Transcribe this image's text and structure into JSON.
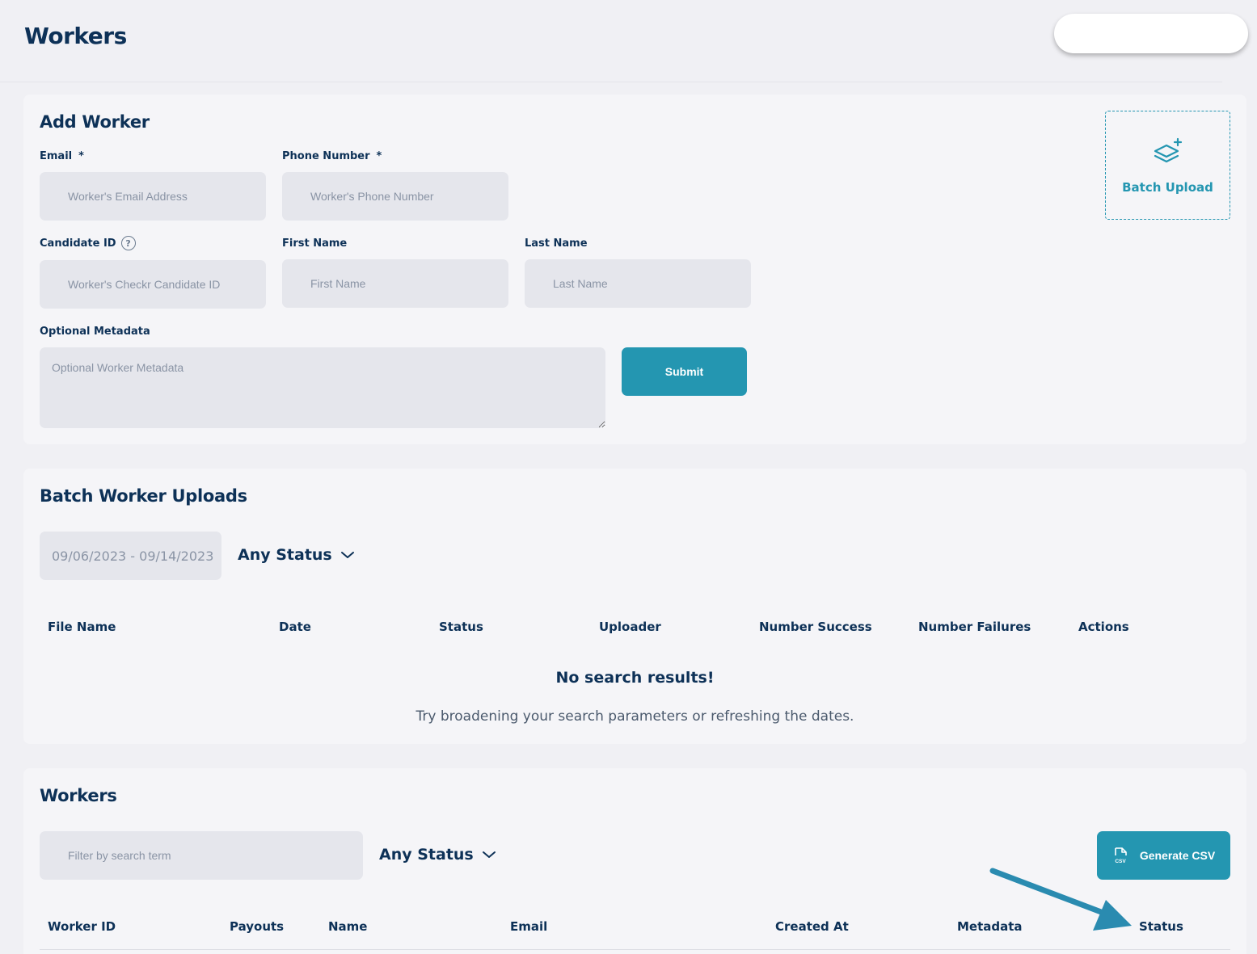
{
  "page": {
    "title": "Workers"
  },
  "add_worker": {
    "title": "Add Worker",
    "email": {
      "label": "Email",
      "required_mark": "*",
      "placeholder": "Worker's Email Address",
      "value": ""
    },
    "phone": {
      "label": "Phone Number",
      "required_mark": "*",
      "placeholder": "Worker's Phone Number",
      "value": ""
    },
    "candidate_id": {
      "label": "Candidate ID",
      "help": "?",
      "placeholder": "Worker's Checkr Candidate ID",
      "value": ""
    },
    "first_name": {
      "label": "First Name",
      "placeholder": "First Name",
      "value": ""
    },
    "last_name": {
      "label": "Last Name",
      "placeholder": "Last Name",
      "value": ""
    },
    "metadata": {
      "label": "Optional Metadata",
      "placeholder": "Optional Worker Metadata",
      "value": ""
    },
    "submit_label": "Submit",
    "batch_upload_label": "Batch Upload"
  },
  "batch_uploads": {
    "title": "Batch Worker Uploads",
    "date_range": "09/06/2023 - 09/14/2023",
    "status_filter": "Any Status",
    "columns": [
      "File Name",
      "Date",
      "Status",
      "Uploader",
      "Number Success",
      "Number Failures",
      "Actions"
    ],
    "empty_title": "No search results!",
    "empty_message": "Try broadening your search parameters or refreshing the dates."
  },
  "workers": {
    "title": "Workers",
    "search": {
      "placeholder": "Filter by search term",
      "value": ""
    },
    "status_filter": "Any Status",
    "generate_csv_label": "Generate CSV",
    "csv_icon_text": "CSV",
    "columns": [
      "Worker ID",
      "Payouts",
      "Name",
      "Email",
      "Created At",
      "Metadata",
      "Status"
    ]
  },
  "colors": {
    "primary": "#2496b1",
    "heading": "#0d3157",
    "input_bg": "#e5e6ec",
    "page_bg": "#f0f0f4"
  }
}
